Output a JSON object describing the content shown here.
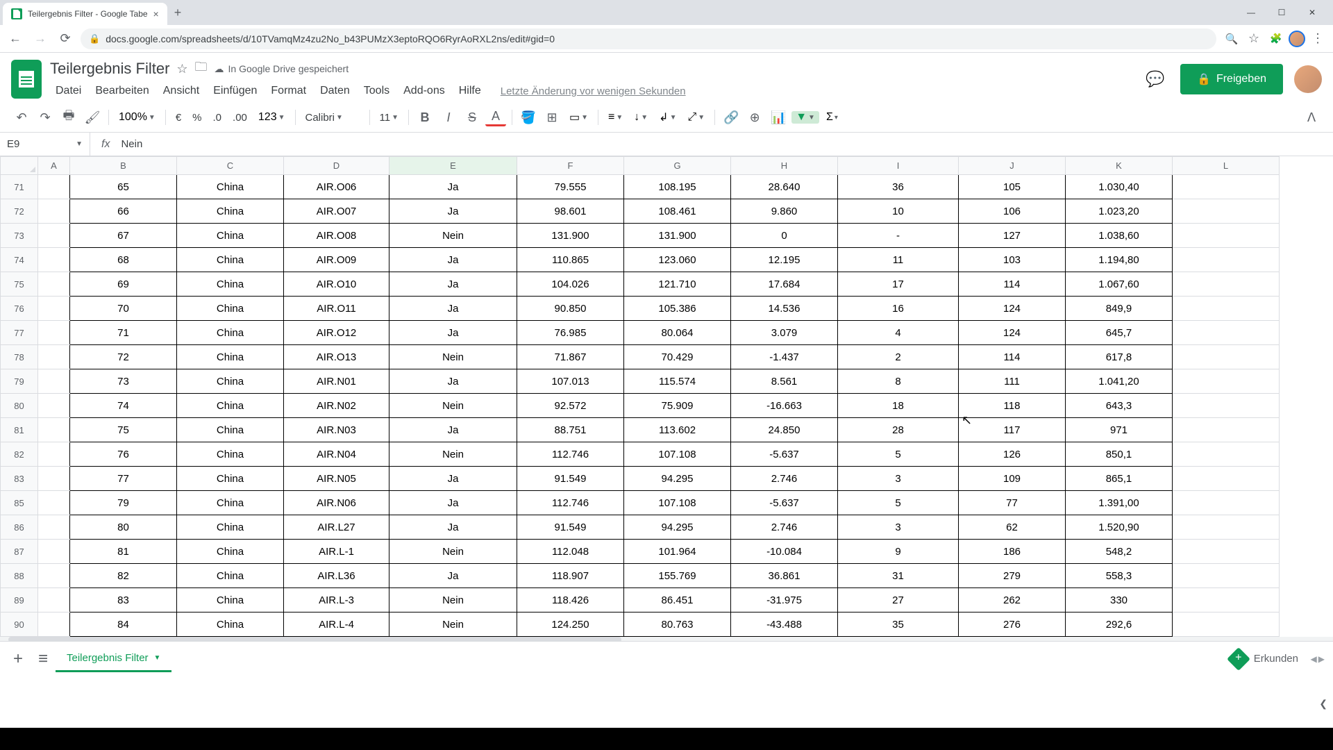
{
  "browser": {
    "tab_title": "Teilergebnis Filter - Google Tabe",
    "url": "docs.google.com/spreadsheets/d/10TVamqMz4zu2No_b43PUMzX3eptoRQO6RyrAoRXL2ns/edit#gid=0"
  },
  "doc": {
    "title": "Teilergebnis Filter",
    "save_status": "In Google Drive gespeichert",
    "last_change": "Letzte Änderung vor wenigen Sekunden"
  },
  "menu": {
    "file": "Datei",
    "edit": "Bearbeiten",
    "view": "Ansicht",
    "insert": "Einfügen",
    "format": "Format",
    "data": "Daten",
    "tools": "Tools",
    "addons": "Add-ons",
    "help": "Hilfe"
  },
  "share_btn": "Freigeben",
  "toolbar": {
    "zoom": "100%",
    "currency": "€",
    "percent": "%",
    "dec_dec": ".0̲",
    "dec_inc": ".00̲",
    "format_num": "123",
    "font": "Calibri",
    "size": "11"
  },
  "namebox": "E9",
  "formula": "Nein",
  "columns": [
    "A",
    "B",
    "C",
    "D",
    "E",
    "F",
    "G",
    "H",
    "I",
    "J",
    "K",
    "L"
  ],
  "rows": [
    {
      "n": "71",
      "b": "65",
      "c": "China",
      "d": "AIR.O06",
      "e": "Ja",
      "f": "79.555",
      "g": "108.195",
      "h": "28.640",
      "i": "36",
      "j": "105",
      "k": "1.030,40"
    },
    {
      "n": "72",
      "b": "66",
      "c": "China",
      "d": "AIR.O07",
      "e": "Ja",
      "f": "98.601",
      "g": "108.461",
      "h": "9.860",
      "i": "10",
      "j": "106",
      "k": "1.023,20"
    },
    {
      "n": "73",
      "b": "67",
      "c": "China",
      "d": "AIR.O08",
      "e": "Nein",
      "f": "131.900",
      "g": "131.900",
      "h": "0",
      "i": "-",
      "j": "127",
      "k": "1.038,60"
    },
    {
      "n": "74",
      "b": "68",
      "c": "China",
      "d": "AIR.O09",
      "e": "Ja",
      "f": "110.865",
      "g": "123.060",
      "h": "12.195",
      "i": "11",
      "j": "103",
      "k": "1.194,80"
    },
    {
      "n": "75",
      "b": "69",
      "c": "China",
      "d": "AIR.O10",
      "e": "Ja",
      "f": "104.026",
      "g": "121.710",
      "h": "17.684",
      "i": "17",
      "j": "114",
      "k": "1.067,60"
    },
    {
      "n": "76",
      "b": "70",
      "c": "China",
      "d": "AIR.O11",
      "e": "Ja",
      "f": "90.850",
      "g": "105.386",
      "h": "14.536",
      "i": "16",
      "j": "124",
      "k": "849,9"
    },
    {
      "n": "77",
      "b": "71",
      "c": "China",
      "d": "AIR.O12",
      "e": "Ja",
      "f": "76.985",
      "g": "80.064",
      "h": "3.079",
      "i": "4",
      "j": "124",
      "k": "645,7"
    },
    {
      "n": "78",
      "b": "72",
      "c": "China",
      "d": "AIR.O13",
      "e": "Nein",
      "f": "71.867",
      "g": "70.429",
      "h": "-1.437",
      "i": "2",
      "j": "114",
      "k": "617,8"
    },
    {
      "n": "79",
      "b": "73",
      "c": "China",
      "d": "AIR.N01",
      "e": "Ja",
      "f": "107.013",
      "g": "115.574",
      "h": "8.561",
      "i": "8",
      "j": "111",
      "k": "1.041,20"
    },
    {
      "n": "80",
      "b": "74",
      "c": "China",
      "d": "AIR.N02",
      "e": "Nein",
      "f": "92.572",
      "g": "75.909",
      "h": "-16.663",
      "i": "18",
      "j": "118",
      "k": "643,3"
    },
    {
      "n": "81",
      "b": "75",
      "c": "China",
      "d": "AIR.N03",
      "e": "Ja",
      "f": "88.751",
      "g": "113.602",
      "h": "24.850",
      "i": "28",
      "j": "117",
      "k": "971"
    },
    {
      "n": "82",
      "b": "76",
      "c": "China",
      "d": "AIR.N04",
      "e": "Nein",
      "f": "112.746",
      "g": "107.108",
      "h": "-5.637",
      "i": "5",
      "j": "126",
      "k": "850,1"
    },
    {
      "n": "83",
      "b": "77",
      "c": "China",
      "d": "AIR.N05",
      "e": "Ja",
      "f": "91.549",
      "g": "94.295",
      "h": "2.746",
      "i": "3",
      "j": "109",
      "k": "865,1"
    },
    {
      "n": "85",
      "b": "79",
      "c": "China",
      "d": "AIR.N06",
      "e": "Ja",
      "f": "112.746",
      "g": "107.108",
      "h": "-5.637",
      "i": "5",
      "j": "77",
      "k": "1.391,00"
    },
    {
      "n": "86",
      "b": "80",
      "c": "China",
      "d": "AIR.L27",
      "e": "Ja",
      "f": "91.549",
      "g": "94.295",
      "h": "2.746",
      "i": "3",
      "j": "62",
      "k": "1.520,90"
    },
    {
      "n": "87",
      "b": "81",
      "c": "China",
      "d": "AIR.L-1",
      "e": "Nein",
      "f": "112.048",
      "g": "101.964",
      "h": "-10.084",
      "i": "9",
      "j": "186",
      "k": "548,2"
    },
    {
      "n": "88",
      "b": "82",
      "c": "China",
      "d": "AIR.L36",
      "e": "Ja",
      "f": "118.907",
      "g": "155.769",
      "h": "36.861",
      "i": "31",
      "j": "279",
      "k": "558,3"
    },
    {
      "n": "89",
      "b": "83",
      "c": "China",
      "d": "AIR.L-3",
      "e": "Nein",
      "f": "118.426",
      "g": "86.451",
      "h": "-31.975",
      "i": "27",
      "j": "262",
      "k": "330"
    },
    {
      "n": "90",
      "b": "84",
      "c": "China",
      "d": "AIR.L-4",
      "e": "Nein",
      "f": "124.250",
      "g": "80.763",
      "h": "-43.488",
      "i": "35",
      "j": "276",
      "k": "292,6"
    }
  ],
  "sheet_tab": "Teilergebnis Filter",
  "explore": "Erkunden"
}
